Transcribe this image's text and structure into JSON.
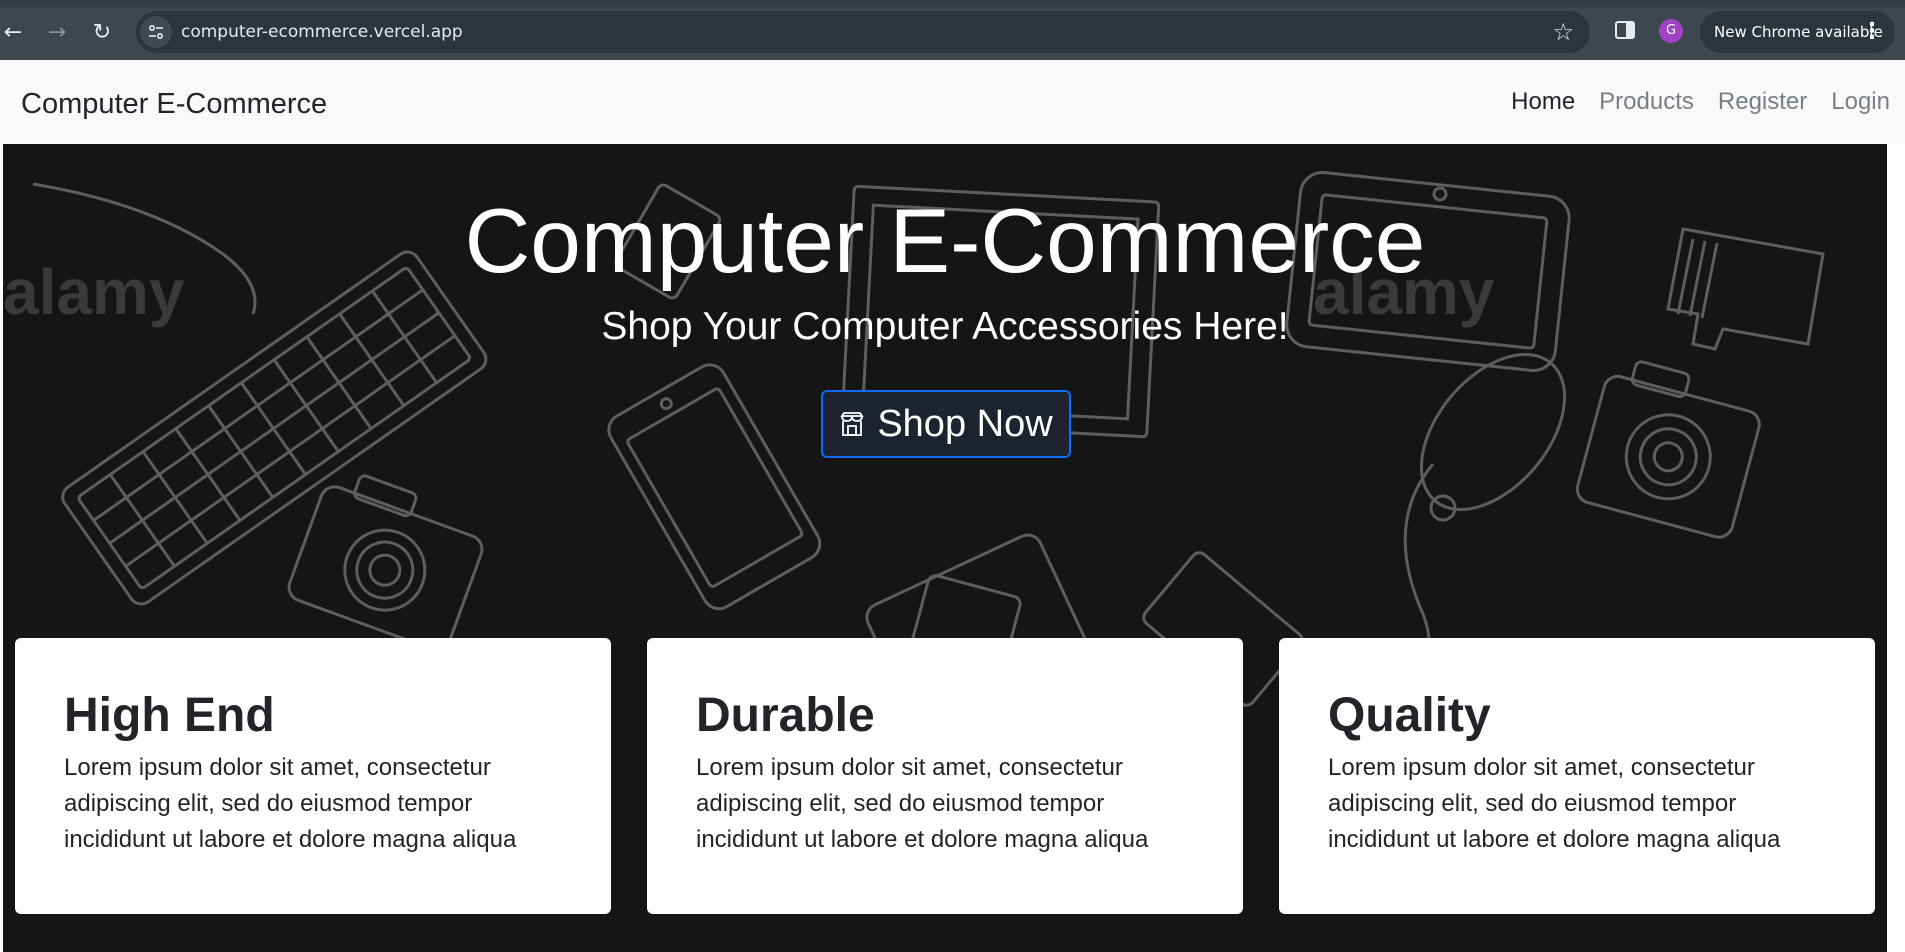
{
  "browser": {
    "url": "computer-ecommerce.vercel.app",
    "profile_initial": "G",
    "update_label": "New Chrome available"
  },
  "navbar": {
    "brand": "Computer E-Commerce",
    "links": [
      {
        "label": "Home",
        "active": true
      },
      {
        "label": "Products",
        "active": false
      },
      {
        "label": "Register",
        "active": false
      },
      {
        "label": "Login",
        "active": false
      }
    ]
  },
  "hero": {
    "title": "Computer E-Commerce",
    "subtitle": "Shop Your Computer Accessories Here!",
    "cta_label": "Shop Now",
    "watermark": "alamy"
  },
  "features": [
    {
      "title": "High End",
      "text": "Lorem ipsum dolor sit amet, consectetur adipiscing elit, sed do eiusmod tempor incididunt ut labore et dolore magna aliqua"
    },
    {
      "title": "Durable",
      "text": "Lorem ipsum dolor sit amet, consectetur adipiscing elit, sed do eiusmod tempor incididunt ut labore et dolore magna aliqua"
    },
    {
      "title": "Quality",
      "text": "Lorem ipsum dolor sit amet, consectetur adipiscing elit, sed do eiusmod tempor incididunt ut labore et dolore magna aliqua"
    }
  ],
  "colors": {
    "hero_background": "#151515",
    "cta_border": "#0d6efd",
    "navbar_background": "#f8f9fa",
    "chrome_toolbar": "#3c474e"
  }
}
